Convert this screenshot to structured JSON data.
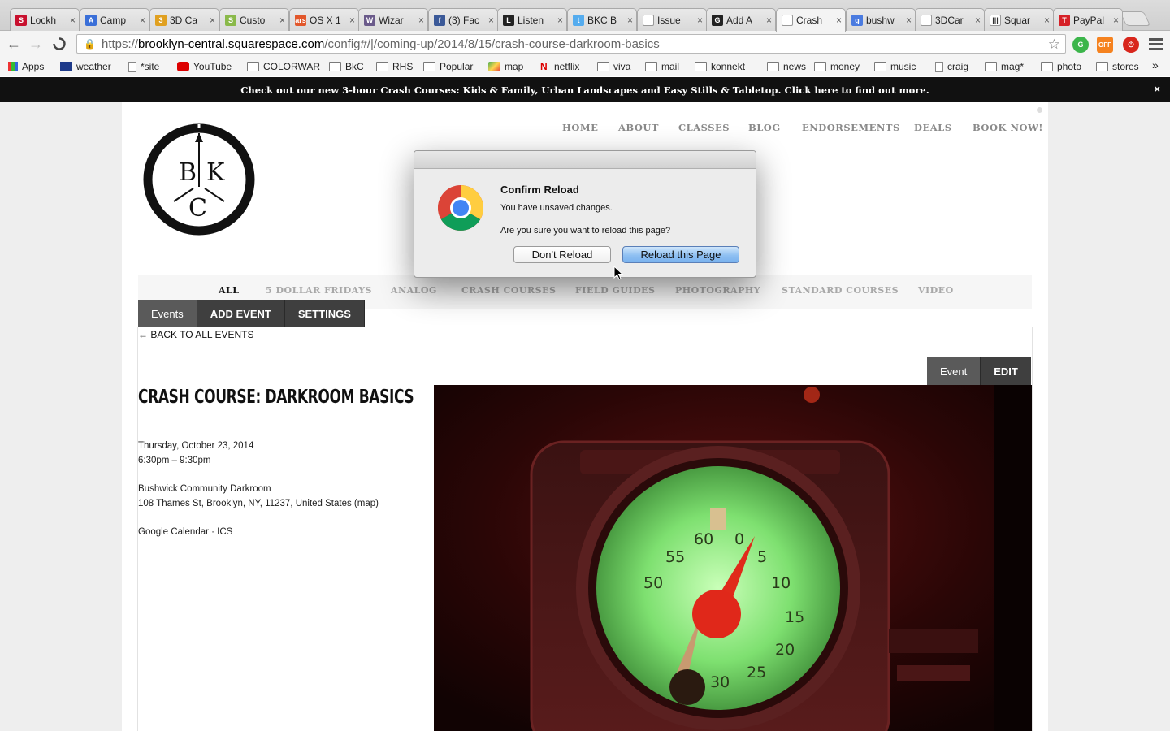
{
  "browser": {
    "tabs": [
      {
        "label": "Lockh",
        "icon": "S",
        "color": "#c8102e"
      },
      {
        "label": "Camp",
        "icon": "A",
        "color": "#3a6fd8"
      },
      {
        "label": "3D Ca",
        "icon": "3",
        "color": "#e0a020"
      },
      {
        "label": "Custo",
        "icon": "S",
        "color": "#8ab94a"
      },
      {
        "label": "OS X 1",
        "icon": "ars",
        "color": "#e2572b"
      },
      {
        "label": "Wizar",
        "icon": "W",
        "color": "#6a5a8a"
      },
      {
        "label": "(3) Fac",
        "icon": "f",
        "color": "#3b5998"
      },
      {
        "label": "Listen",
        "icon": "L",
        "color": "#222222"
      },
      {
        "label": "BKC B",
        "icon": "t",
        "color": "#55acee"
      },
      {
        "label": "Issue",
        "icon": "",
        "color": "#ffffff"
      },
      {
        "label": "Add A",
        "icon": "G",
        "color": "#222222"
      },
      {
        "label": "Crash",
        "icon": "",
        "color": "#ffffff",
        "active": true
      },
      {
        "label": "bushw",
        "icon": "g",
        "color": "#4a7be0"
      },
      {
        "label": "3DCar",
        "icon": "",
        "color": "#ffffff"
      },
      {
        "label": "Squar",
        "icon": "|||",
        "color": "#ffffff"
      },
      {
        "label": "PayPal",
        "icon": "T",
        "color": "#d62027"
      }
    ],
    "url": {
      "scheme": "https://",
      "host": "brooklyn-central.squarespace.com",
      "path": "/config#/|/coming-up/2014/8/15/crash-course-darkroom-basics"
    },
    "bookmarks": [
      {
        "label": "Apps",
        "icon": "apps-icon"
      },
      {
        "label": "weather",
        "icon": "twc-icon"
      },
      {
        "label": "*site",
        "icon": "page-icon"
      },
      {
        "label": "YouTube",
        "icon": "youtube-icon"
      },
      {
        "label": "COLORWAR",
        "icon": "folder-icon"
      },
      {
        "label": "BkC",
        "icon": "folder-icon"
      },
      {
        "label": "RHS",
        "icon": "folder-icon"
      },
      {
        "label": "Popular",
        "icon": "folder-icon"
      },
      {
        "label": "map",
        "icon": "maps-icon"
      },
      {
        "label": "netflix",
        "icon": "netflix-icon"
      },
      {
        "label": "viva",
        "icon": "folder-icon"
      },
      {
        "label": "mail",
        "icon": "folder-icon"
      },
      {
        "label": "konnekt",
        "icon": "folder-icon"
      },
      {
        "label": "news",
        "icon": "folder-icon"
      },
      {
        "label": "money",
        "icon": "folder-icon"
      },
      {
        "label": "music",
        "icon": "folder-icon"
      },
      {
        "label": "craig",
        "icon": "page-icon"
      },
      {
        "label": "mag*",
        "icon": "folder-icon"
      },
      {
        "label": "photo",
        "icon": "folder-icon"
      },
      {
        "label": "stores",
        "icon": "folder-icon"
      }
    ],
    "bookmarks_overflow": "»",
    "ext_off_label": "OFF"
  },
  "announcement": {
    "text": "Check out our new 3-hour Crash Courses: Kids & Family, Urban Landscapes and Easy Stills & Tabletop.  Click here to find out more.",
    "close": "×"
  },
  "site": {
    "logo_letters": {
      "b": "B",
      "k": "K",
      "c": "C"
    },
    "nav": [
      "HOME",
      "ABOUT",
      "CLASSES",
      "BLOG",
      "ENDORSEMENTS",
      "DEALS",
      "BOOK NOW!"
    ],
    "categories": [
      "ALL",
      "5 DOLLAR FRIDAYS",
      "ANALOG",
      "CRASH COURSES",
      "FIELD GUIDES",
      "PHOTOGRAPHY",
      "STANDARD COURSES",
      "VIDEO"
    ],
    "admin_tabs": [
      "Events",
      "ADD EVENT",
      "SETTINGS"
    ],
    "back_link": "← BACK TO ALL EVENTS",
    "event_tabs": [
      "Event",
      "EDIT"
    ]
  },
  "event": {
    "title": "CRASH COURSE: DARKROOM BASICS",
    "date": "Thursday, October 23, 2014",
    "time": "6:30pm – 9:30pm",
    "venue": "Bushwick Community Darkroom",
    "address": "108 Thames St, Brooklyn, NY, 11237, United States (map)",
    "calendar_links": "Google Calendar  ·  ICS",
    "timer_numbers": [
      "60",
      "0",
      "55",
      "5",
      "50",
      "10",
      "15",
      "20",
      "25",
      "30"
    ]
  },
  "dialog": {
    "title": "Confirm Reload",
    "message1": "You have unsaved changes.",
    "message2": "Are you sure you want to reload this page?",
    "cancel_label": "Don't Reload",
    "confirm_label": "Reload this Page"
  }
}
